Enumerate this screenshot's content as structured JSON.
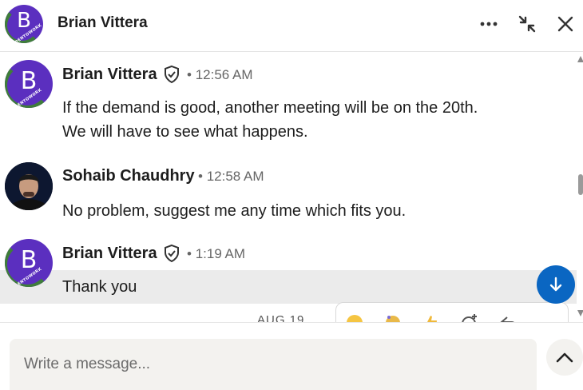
{
  "header": {
    "title": "Brian Vittera",
    "avatar_letter": "B",
    "avatar_ring_text": "#OPENTOWORK"
  },
  "messages": [
    {
      "sender": "Brian Vittera",
      "verified": true,
      "time": "12:56 AM",
      "avatar_letter": "B",
      "lines": [
        "If the demand is good, another meeting will be on the 20th.",
        "We will have to see what happens."
      ]
    },
    {
      "sender": "Sohaib Chaudhry",
      "verified": false,
      "time": "12:58 AM",
      "lines": [
        "No problem, suggest me any time which fits you."
      ]
    },
    {
      "sender": "Brian Vittera",
      "verified": true,
      "time": "1:19 AM",
      "avatar_letter": "B",
      "lines": [
        "Thank you"
      ]
    }
  ],
  "date_separator": "AUG 19",
  "separator_dot": "•",
  "composer": {
    "placeholder": "Write a message..."
  },
  "colors": {
    "accent": "#0a66c2",
    "avatar_bg": "#5b2fbf",
    "opentowork_ring": "#3f7d3a",
    "highlight_row": "#ebebeb"
  },
  "icons": {
    "more": "more-options-icon",
    "minimize": "minimize-icon",
    "close": "close-icon",
    "verified": "verified-shield-icon",
    "jump": "arrow-down-icon",
    "expand": "chevron-up-icon"
  }
}
